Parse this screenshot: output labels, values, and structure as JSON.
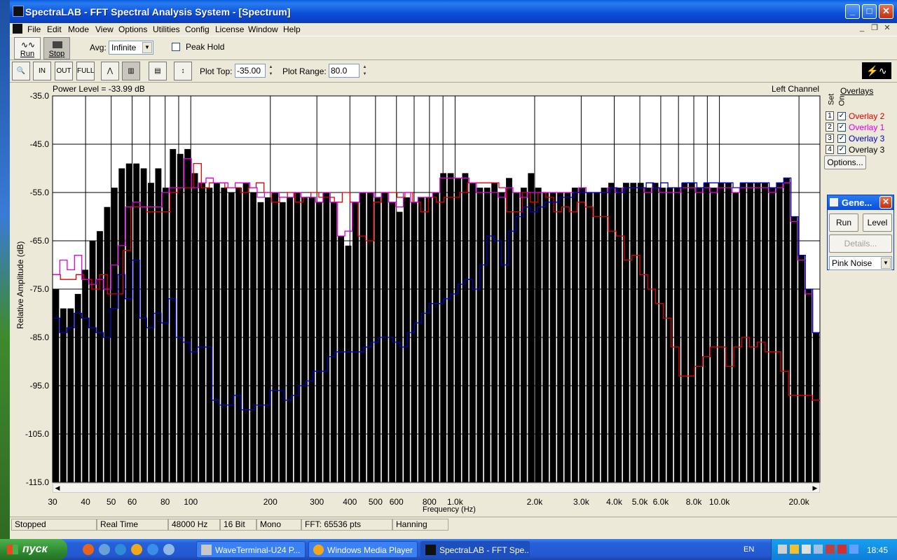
{
  "window": {
    "title": "SpectraLAB - FFT Spectral Analysis System - [Spectrum]",
    "controls": [
      "_",
      "□",
      "✕"
    ]
  },
  "menu": [
    "File",
    "Edit",
    "Mode",
    "View",
    "Options",
    "Utilities",
    "Config",
    "License",
    "Window",
    "Help"
  ],
  "toolbar1": {
    "run_label": "Run",
    "stop_label": "Stop",
    "avg_label": "Avg:",
    "avg_value": "Infinite",
    "peak_hold_label": "Peak Hold"
  },
  "toolbar2": {
    "plot_top_label": "Plot Top:",
    "plot_top_value": "-35.00",
    "plot_range_label": "Plot Range:",
    "plot_range_value": "80.0"
  },
  "chart_header": {
    "power_level": "Power Level = -33.99 dB",
    "channel": "Left Channel"
  },
  "overlays": {
    "title": "Overlays",
    "col_set": "Set",
    "col_on": "On",
    "items": [
      {
        "num": "1",
        "label": "Overlay 2",
        "color": "#e00000"
      },
      {
        "num": "2",
        "label": "Overlay 1",
        "color": "#e000e0"
      },
      {
        "num": "3",
        "label": "Overlay 3",
        "color": "#0000c0"
      },
      {
        "num": "4",
        "label": "Overlay 3",
        "color": "#000000"
      }
    ],
    "options_label": "Options..."
  },
  "generator": {
    "title": "Gene...",
    "run_label": "Run",
    "level_label": "Level",
    "details_label": "Details...",
    "signal": "Pink Noise"
  },
  "status": [
    "Stopped",
    "Real Time",
    "48000 Hz",
    "16 Bit",
    "Mono",
    "FFT: 65536 pts",
    "Hanning"
  ],
  "taskbar": {
    "start_label": "пуск",
    "tasks": [
      "WaveTerminal-U24 P...",
      "Windows Media Player",
      "SpectraLAB - FFT Spe..."
    ],
    "lang": "EN",
    "clock": "18:45"
  },
  "chart_data": {
    "type": "bar",
    "xlabel": "Frequency (Hz)",
    "ylabel": "Relative Amplitude (dB)",
    "ylim": [
      -115,
      -35
    ],
    "xlim": [
      30,
      24000
    ],
    "x_scale": "log",
    "yticks": [
      "-35.0",
      "-45.0",
      "-55.0",
      "-65.0",
      "-75.0",
      "-85.0",
      "-95.0",
      "-105.0",
      "-115.0"
    ],
    "xticks": [
      {
        "v": 30,
        "l": "30"
      },
      {
        "v": 40,
        "l": "40"
      },
      {
        "v": 50,
        "l": "50"
      },
      {
        "v": 60,
        "l": "60"
      },
      {
        "v": 80,
        "l": "80"
      },
      {
        "v": 100,
        "l": "100"
      },
      {
        "v": 200,
        "l": "200"
      },
      {
        "v": 300,
        "l": "300"
      },
      {
        "v": 400,
        "l": "400"
      },
      {
        "v": 500,
        "l": "500"
      },
      {
        "v": 600,
        "l": "600"
      },
      {
        "v": 800,
        "l": "800"
      },
      {
        "v": 1000,
        "l": "1.0k"
      },
      {
        "v": 2000,
        "l": "2.0k"
      },
      {
        "v": 3000,
        "l": "3.0k"
      },
      {
        "v": 4000,
        "l": "4.0k"
      },
      {
        "v": 5000,
        "l": "5.0k"
      },
      {
        "v": 6000,
        "l": "6.0k"
      },
      {
        "v": 8000,
        "l": "8.0k"
      },
      {
        "v": 10000,
        "l": "10.0k"
      },
      {
        "v": 20000,
        "l": "20.0k"
      }
    ],
    "grid": true,
    "bars_db": [
      -75,
      -79,
      -79,
      -76,
      -71,
      -65,
      -63,
      -58,
      -54,
      -50,
      -49,
      -49,
      -50,
      -53,
      -50,
      -54,
      -46,
      -47,
      -46,
      -51,
      -53,
      -54,
      -53,
      -54,
      -55,
      -54,
      -53,
      -55,
      -57,
      -56,
      -55,
      -57,
      -56,
      -55,
      -56,
      -56,
      -57,
      -55,
      -57,
      -64,
      -66,
      -57,
      -55,
      -55,
      -56,
      -55,
      -57,
      -59,
      -56,
      -57,
      -56,
      -56,
      -55,
      -51,
      -51,
      -52,
      -51,
      -53,
      -54,
      -54,
      -53,
      -55,
      -52,
      -55,
      -54,
      -51,
      -54,
      -55,
      -55,
      -55,
      -55,
      -54,
      -54,
      -55,
      -55,
      -54,
      -53,
      -54,
      -53,
      -53,
      -53,
      -54,
      -53,
      -54,
      -54,
      -54,
      -53,
      -53,
      -54,
      -53,
      -54,
      -53,
      -53,
      -55,
      -53,
      -53,
      -53,
      -53,
      -54,
      -53,
      -52,
      -60,
      -68,
      -75,
      -84
    ],
    "overlays": [
      {
        "name": "Overlay 2",
        "color": "#e00000",
        "values": [
          -72,
          -73,
          -73,
          -72,
          -73,
          -75,
          -72,
          -76,
          -76,
          -67,
          -58,
          -58,
          -59,
          -59,
          -59,
          -55,
          -54,
          -54,
          -49,
          -54,
          -53,
          -53,
          -54,
          -54,
          -55,
          -54,
          -53,
          -55,
          -57,
          -56,
          -55,
          -57,
          -56,
          -55,
          -56,
          -56,
          -57,
          -55,
          -57,
          -64,
          -65,
          -57,
          -55,
          -55,
          -56,
          -55,
          -57,
          -59,
          -56,
          -57,
          -56,
          -56,
          -55,
          -53,
          -53,
          -53,
          -53,
          -54,
          -59,
          -59,
          -55,
          -57,
          -55,
          -56,
          -59,
          -58,
          -59,
          -57,
          -58,
          -60,
          -60,
          -63,
          -64,
          -69,
          -68,
          -72,
          -75,
          -78,
          -81,
          -87,
          -93,
          -93,
          -91,
          -89,
          -87,
          -87,
          -91,
          -87,
          -85,
          -87,
          -86,
          -88,
          -88,
          -92,
          -97,
          -97,
          -97,
          -98
        ]
      },
      {
        "name": "Overlay 1",
        "color": "#e000e0",
        "values": [
          -72,
          -69,
          -71,
          -68,
          -73,
          -74,
          -73,
          -75,
          -70,
          -66,
          -58,
          -57,
          -58,
          -58,
          -58,
          -55,
          -54,
          -54,
          -48,
          -54,
          -53,
          -52,
          -53,
          -53,
          -54,
          -53,
          -53,
          -54,
          -56,
          -55,
          -55,
          -56,
          -56,
          -55,
          -56,
          -56,
          -57,
          -55,
          -57,
          -64,
          -63,
          -57,
          -55,
          -55,
          -56,
          -55,
          -57,
          -58,
          -55,
          -57,
          -56,
          -56,
          -55,
          -52,
          -52,
          -52,
          -52,
          -53,
          -55,
          -55,
          -55,
          -56,
          -54,
          -55,
          -56,
          -55,
          -55,
          -55,
          -55,
          -55,
          -55,
          -55,
          -54,
          -55,
          -55,
          -55,
          -54,
          -55,
          -54,
          -54,
          -54,
          -55,
          -54,
          -55,
          -55,
          -55,
          -54,
          -54,
          -55,
          -54,
          -55,
          -54,
          -54,
          -55,
          -54,
          -54,
          -54,
          -54,
          -55,
          -54,
          -53,
          -61,
          -69,
          -76,
          -84
        ]
      },
      {
        "name": "Overlay 3",
        "color": "#0000c0",
        "values": [
          -81,
          -84,
          -83,
          -80,
          -81,
          -83,
          -84,
          -85,
          -79,
          -72,
          -77,
          -69,
          -81,
          -83,
          -80,
          -82,
          -77,
          -85,
          -86,
          -88,
          -87,
          -87,
          -98,
          -99,
          -99,
          -97,
          -100,
          -100,
          -99,
          -99,
          -96,
          -96,
          -98,
          -97,
          -95,
          -94,
          -92,
          -92,
          -89,
          -88,
          -88,
          -88,
          -88,
          -87,
          -86,
          -85,
          -85,
          -86,
          -87,
          -84,
          -82,
          -80,
          -78,
          -78,
          -77,
          -76,
          -74,
          -73,
          -75,
          -70,
          -64,
          -65,
          -70,
          -63,
          -60,
          -58,
          -59,
          -58,
          -57,
          -57,
          -56,
          -56,
          -55,
          -55,
          -55,
          -55,
          -55,
          -54,
          -55,
          -54,
          -54,
          -54,
          -53,
          -54,
          -53,
          -54,
          -54,
          -53,
          -53,
          -54,
          -53,
          -53,
          -53,
          -53,
          -54,
          -53,
          -53,
          -53,
          -53,
          -54,
          -53,
          -52,
          -60,
          -68,
          -75,
          -84
        ]
      }
    ]
  }
}
